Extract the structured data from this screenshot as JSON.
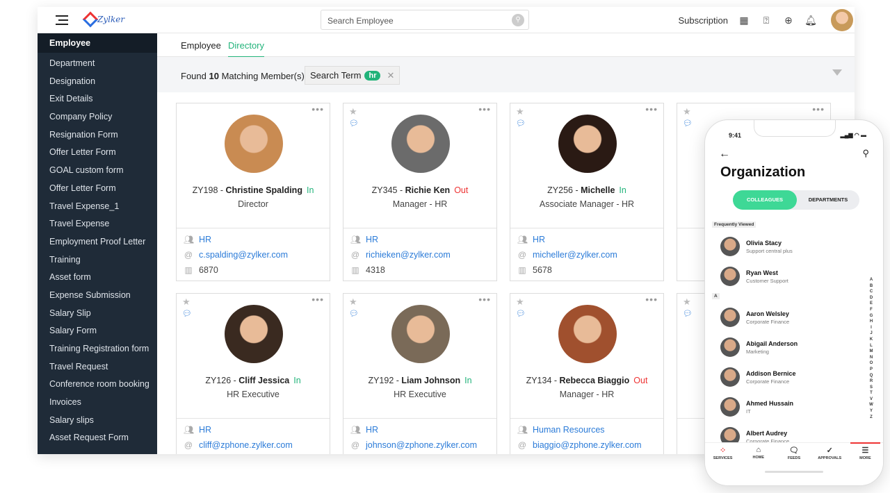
{
  "header": {
    "brand": "Zylker",
    "search_placeholder": "Search Employee",
    "subscription": "Subscription"
  },
  "sidebar": {
    "items": [
      "Employee",
      "Department",
      "Designation",
      "Exit Details",
      "Company Policy",
      "Resignation Form",
      "Offer Letter Form",
      "GOAL custom form",
      "Offer Letter Form",
      "Travel Expense_1",
      "Travel Expense",
      "Employment Proof Letter",
      "Training",
      "Asset form",
      "Expense Submission",
      "Salary Slip",
      "Salary Form",
      "Training Registration form",
      "Travel Request",
      "Conference room booking",
      "Invoices",
      "Salary slips",
      "Asset Request Form"
    ],
    "active": "Employee"
  },
  "tabs": [
    {
      "label": "Employee"
    },
    {
      "label": "Directory",
      "active": true
    }
  ],
  "filter": {
    "found_prefix": "Found",
    "count": "10",
    "found_suffix": "Matching Member(s)",
    "chip_label": "Search Term",
    "chip_value": "hr"
  },
  "colors": {
    "accent": "#21b37a",
    "link": "#2b7bd8",
    "out": "#e33333",
    "sidebar": "#1f2b38"
  },
  "employees": [
    {
      "id": "ZY198",
      "name": "Christine Spalding",
      "status": "In",
      "designation": "Director",
      "department": "HR",
      "email": "c.spalding@zylker.com",
      "ext": "6870"
    },
    {
      "id": "ZY345",
      "name": "Richie Ken",
      "status": "Out",
      "designation": "Manager - HR",
      "department": "HR",
      "email": "richieken@zylker.com",
      "ext": "4318"
    },
    {
      "id": "ZY256",
      "name": "Michelle",
      "status": "In",
      "designation": "Associate  Manager - HR",
      "department": "HR",
      "email": "micheller@zylker.com",
      "ext": "5678"
    },
    {
      "id": "ZY126",
      "name": "Cliff Jessica",
      "status": "In",
      "designation": "HR Executive",
      "department": "HR",
      "email": "cliff@zphone.zylker.com"
    },
    {
      "id": "ZY192",
      "name": "Liam Johnson",
      "status": "In",
      "designation": "HR Executive",
      "department": "HR",
      "email": "johnson@zphone.zylker.com"
    },
    {
      "id": "ZY134",
      "name": "Rebecca Biaggio",
      "status": "Out",
      "designation": "Manager - HR",
      "department": "Human Resources",
      "email": "biaggio@zphone.zylker.com"
    }
  ],
  "phone": {
    "time": "9:41",
    "title": "Organization",
    "seg_colleagues": "COLLEAGUES",
    "seg_departments": "DEPARTMENTS",
    "frequent_label": "Frequently Viewed",
    "frequent": [
      {
        "name": "Olivia Stacy",
        "dept": "Support central plus"
      },
      {
        "name": "Ryan West",
        "dept": "Customer Support"
      }
    ],
    "section": "A",
    "list": [
      {
        "name": "Aaron Welsley",
        "dept": "Corporate Finance"
      },
      {
        "name": "Abigail Anderson",
        "dept": "Marketing"
      },
      {
        "name": "Addison Bernice",
        "dept": "Corporate Finance"
      },
      {
        "name": "Ahmed Hussain",
        "dept": "IT"
      },
      {
        "name": "Albert Audrey",
        "dept": "Corporate Finance"
      }
    ],
    "alphabet": "A B C D E F G H I J K L M N O P Q R S T V W Y Z",
    "nav": [
      "SERVICES",
      "HOME",
      "FEEDS",
      "APPROVALS",
      "MORE"
    ]
  }
}
